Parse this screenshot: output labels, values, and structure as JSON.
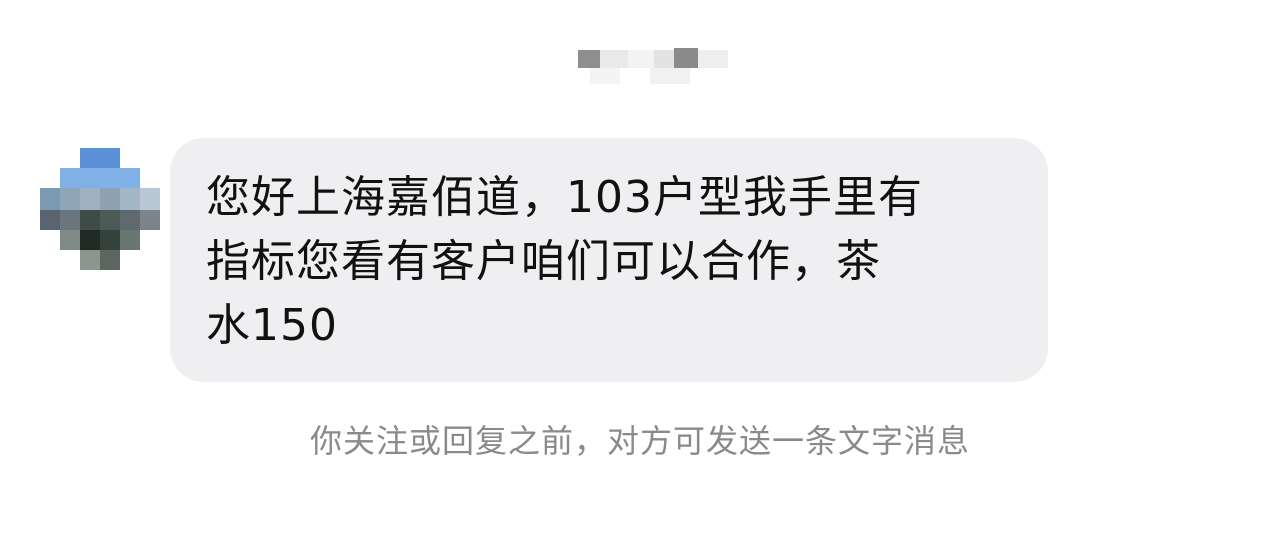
{
  "header": {
    "contact_name_pixelated": true
  },
  "contact": {
    "avatar": "pixelated-avatar"
  },
  "message": {
    "lines": [
      "您好上海嘉佰道，103户型我手里有",
      "指标您看有客户咱们可以合作，茶",
      "水150"
    ]
  },
  "notice": {
    "text": "你关注或回复之前，对方可发送一条文字消息"
  },
  "colors": {
    "bubble_bg": "#efeff1",
    "message_text": "#111111",
    "notice_text": "#8a8a8e"
  }
}
